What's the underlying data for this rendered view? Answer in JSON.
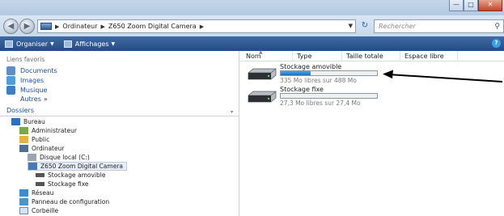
{
  "window": {
    "minimize_label": "—",
    "maximize_label": "□",
    "close_label": "✕"
  },
  "address": {
    "back_glyph": "◀",
    "forward_glyph": "▶",
    "breadcrumbs": [
      "Ordinateur",
      "Z650 Zoom Digital Camera"
    ],
    "search_placeholder": "Rechercher"
  },
  "toolbar": {
    "organize_label": "Organiser",
    "views_label": "Affichages",
    "help_label": "?"
  },
  "nav": {
    "favorites_heading": "Liens favoris",
    "favorites": [
      {
        "label": "Documents",
        "icon": "documents-icon"
      },
      {
        "label": "Images",
        "icon": "images-icon"
      },
      {
        "label": "Musique",
        "icon": "music-icon"
      }
    ],
    "more_label": "Autres",
    "folders_heading": "Dossiers",
    "tree": [
      {
        "label": "Bureau",
        "icon": "desktop-icon"
      },
      {
        "label": "Administrateur",
        "icon": "user-folder-icon"
      },
      {
        "label": "Public",
        "icon": "public-folder-icon"
      },
      {
        "label": "Ordinateur",
        "icon": "computer-icon"
      },
      {
        "label": "Disque local (C:)",
        "icon": "hard-disk-icon"
      },
      {
        "label": "Z650 Zoom Digital Camera",
        "icon": "camera-device-icon"
      },
      {
        "label": "Stockage amovible",
        "icon": "removable-storage-icon"
      },
      {
        "label": "Stockage fixe",
        "icon": "fixed-storage-icon"
      },
      {
        "label": "Réseau",
        "icon": "network-icon"
      },
      {
        "label": "Panneau de configuration",
        "icon": "control-panel-icon"
      },
      {
        "label": "Corbeille",
        "icon": "recycle-bin-icon"
      }
    ]
  },
  "columns": [
    "Nom",
    "Type",
    "Taille totale",
    "Espace libre"
  ],
  "drives": [
    {
      "name": "Stockage amovible",
      "free_text": "335 Mo libres sur 488 Mo",
      "used_fraction": 0.31
    },
    {
      "name": "Stockage fixe",
      "free_text": "27,3 Mo libres sur 27,4 Mo",
      "used_fraction": 0.004
    }
  ],
  "colors": {
    "accent": "#2b5fa6",
    "toolbar": "#2f5a93",
    "capacity_fill": "#2a86d6",
    "annotation_arrow": "#000000"
  }
}
